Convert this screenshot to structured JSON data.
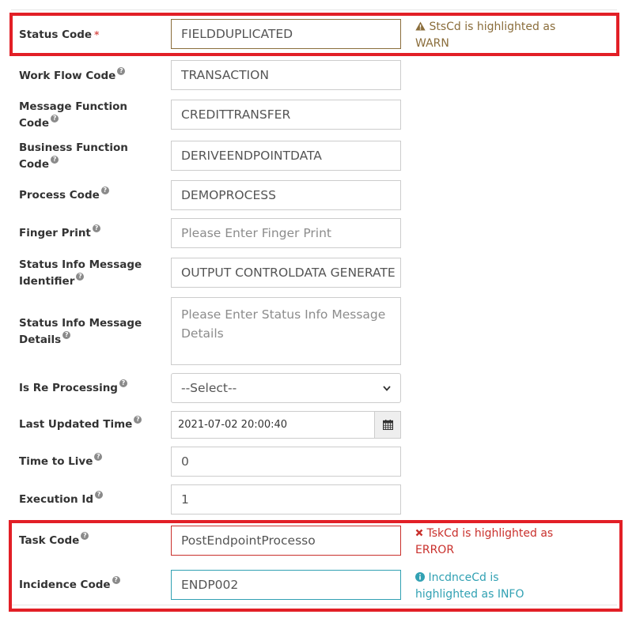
{
  "fields": {
    "status_code": {
      "label": "Status Code",
      "required_mark": "*",
      "value": "FIELDDUPLICATED"
    },
    "work_flow_code": {
      "label": "Work Flow Code",
      "value": "TRANSACTION"
    },
    "message_function_code": {
      "label": "Message Function Code",
      "value": "CREDITTRANSFER"
    },
    "business_function_code": {
      "label": "Business Function Code",
      "value": "DERIVEENDPOINTDATA"
    },
    "process_code": {
      "label": "Process Code",
      "value": "DEMOPROCESS"
    },
    "finger_print": {
      "label": "Finger Print",
      "placeholder": "Please Enter Finger Print"
    },
    "status_info_message_identifier": {
      "label": "Status Info Message Identifier",
      "value": "OUTPUT CONTROLDATA GENERATE"
    },
    "status_info_message_details": {
      "label": "Status Info Message Details",
      "placeholder": "Please Enter Status Info Message Details"
    },
    "is_re_processing": {
      "label": "Is Re Processing",
      "selected": "--Select--"
    },
    "last_updated_time": {
      "label": "Last Updated Time",
      "value": "2021-07-02 20:00:40"
    },
    "time_to_live": {
      "label": "Time to Live",
      "value": "0"
    },
    "execution_id": {
      "label": "Execution Id",
      "value": "1"
    },
    "task_code": {
      "label": "Task Code",
      "value": "PostEndpointProcesso"
    },
    "incidence_code": {
      "label": "Incidence Code",
      "value": "ENDP002"
    }
  },
  "messages": {
    "warn": {
      "icon": "warning-icon",
      "text": "StsCd is highlighted as WARN",
      "color": "#8a6d3b"
    },
    "error": {
      "icon": "times-icon",
      "text": "TskCd is highlighted as ERROR",
      "color": "#c9302c"
    },
    "info": {
      "icon": "info-circle-icon",
      "text": "IncdnceCd is highlighted as INFO",
      "color": "#31a1b3"
    }
  },
  "highlight_color": "#e21f26",
  "help_icon": "question-circle-icon"
}
